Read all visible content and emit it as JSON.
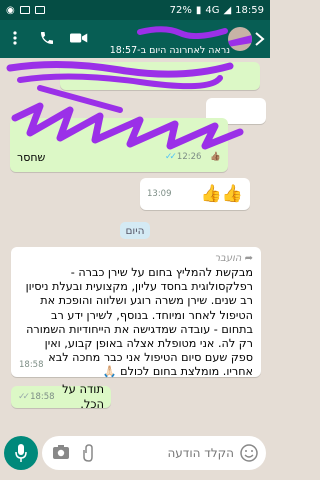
{
  "status": {
    "battery": "72%",
    "network": "4G",
    "time": "18:59"
  },
  "header": {
    "subtitle": "נראה לאחרונה היום ב-18:57"
  },
  "messages": [
    {
      "text": "",
      "time": ""
    },
    {
      "text": "שחסר",
      "time": "12:26"
    },
    {
      "text": "👍👍",
      "time": "13:09"
    }
  ],
  "date_chip": "היום",
  "forwarded": {
    "label": "הועבר",
    "text": "מבקשת להמליץ בחום על שירן כברה - רפלקסולוגית בחסד עליון, מקצועית ובעלת ניסיון רב שנים. שירן משרה רוגע ושלווה והופכת את הטיפול לאחר ומיוחד. בנוסף, לשירן ידע רב בתחום - עובדה שמדגישה את הייחודיות השמורה רק לה. אני מטופלת אצלה באופן קבוע, ואין ספק שעם סיום הטיפול אני כבר מחכה לבא אחריו. מומלצת בחום לכולם 🙏🏻",
    "time": "18:58"
  },
  "reply": {
    "text": "תודה על הכל.",
    "time": "18:58"
  },
  "composer": {
    "placeholder": "הקלד הודעה"
  },
  "colors": {
    "appbar": "#075e54",
    "statusbar": "#054d44",
    "outgoing": "#dcf8c6",
    "scribble": "#9b30e8",
    "fab": "#00897b"
  }
}
